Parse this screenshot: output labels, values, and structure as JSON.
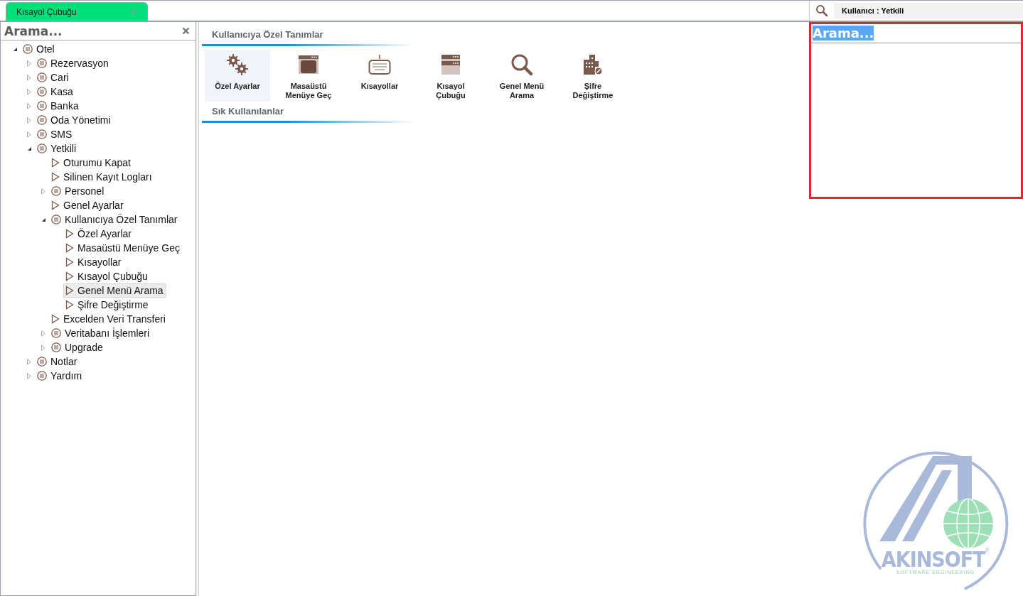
{
  "tabs": [
    {
      "label": "Kısayol Çubuğu",
      "selected": true
    }
  ],
  "user": {
    "label": "Kullanıcı : Yetkili"
  },
  "tree_panel": {
    "search_placeholder": "Arama...",
    "items": [
      {
        "label": "Otel",
        "kind": "group",
        "expanded": true,
        "selected": false,
        "children": [
          {
            "label": "Rezervasyon",
            "kind": "group",
            "expanded": false,
            "selected": false
          },
          {
            "label": "Cari",
            "kind": "group",
            "expanded": false,
            "selected": false
          },
          {
            "label": "Kasa",
            "kind": "group",
            "expanded": false,
            "selected": false
          },
          {
            "label": "Banka",
            "kind": "group",
            "expanded": false,
            "selected": false
          },
          {
            "label": "Oda Yönetimi",
            "kind": "group",
            "expanded": false,
            "selected": false
          },
          {
            "label": "SMS",
            "kind": "group",
            "expanded": false,
            "selected": false
          },
          {
            "label": "Yetkili",
            "kind": "group",
            "expanded": true,
            "selected": false,
            "children": [
              {
                "label": "Oturumu Kapat",
                "kind": "leaf",
                "selected": false
              },
              {
                "label": "Silinen Kayıt Logları",
                "kind": "leaf",
                "selected": false
              },
              {
                "label": "Personel",
                "kind": "group",
                "expanded": false,
                "selected": false
              },
              {
                "label": "Genel Ayarlar",
                "kind": "leaf",
                "selected": false
              },
              {
                "label": "Kullanıcıya Özel Tanımlar",
                "kind": "group",
                "expanded": true,
                "selected": false,
                "children": [
                  {
                    "label": "Özel Ayarlar",
                    "kind": "leaf",
                    "selected": false
                  },
                  {
                    "label": "Masaüstü Menüye Geç",
                    "kind": "leaf",
                    "selected": false
                  },
                  {
                    "label": "Kısayollar",
                    "kind": "leaf",
                    "selected": false
                  },
                  {
                    "label": "Kısayol Çubuğu",
                    "kind": "leaf",
                    "selected": false
                  },
                  {
                    "label": "Genel Menü Arama",
                    "kind": "leaf",
                    "selected": true
                  },
                  {
                    "label": "Şifre Değiştirme",
                    "kind": "leaf",
                    "selected": false
                  }
                ]
              },
              {
                "label": "Excelden Veri Transferi",
                "kind": "leaf",
                "selected": false
              },
              {
                "label": "Veritabanı İşlemleri",
                "kind": "group",
                "expanded": false,
                "selected": false
              },
              {
                "label": "Upgrade",
                "kind": "group",
                "expanded": false,
                "selected": false
              }
            ]
          },
          {
            "label": "Notlar",
            "kind": "group",
            "expanded": false,
            "selected": false
          },
          {
            "label": "Yardım",
            "kind": "group",
            "expanded": false,
            "selected": false
          }
        ]
      }
    ]
  },
  "sections": [
    {
      "title": "Kullanıcıya Özel Tanımlar",
      "items": [
        {
          "label": "Özel Ayarlar",
          "kind": "gears",
          "selected": true
        },
        {
          "label": "Masaüstü Menüye Geç",
          "kind": "window",
          "selected": false
        },
        {
          "label": "Kısayollar",
          "kind": "keyboard",
          "selected": false
        },
        {
          "label": "Kısayol Çubuğu",
          "kind": "toolbar",
          "selected": false
        },
        {
          "label": "Genel Menü Arama",
          "kind": "search",
          "selected": false
        },
        {
          "label": "Şifre Değiştirme",
          "kind": "building",
          "selected": false
        }
      ]
    },
    {
      "title": "Sık Kullanılanlar"
    }
  ],
  "search_panel": {
    "value": "Arama..."
  },
  "logo": {
    "name": "AKINSOFT",
    "mark": "®",
    "tagline": "SOFTWARE ENGINEERING"
  }
}
